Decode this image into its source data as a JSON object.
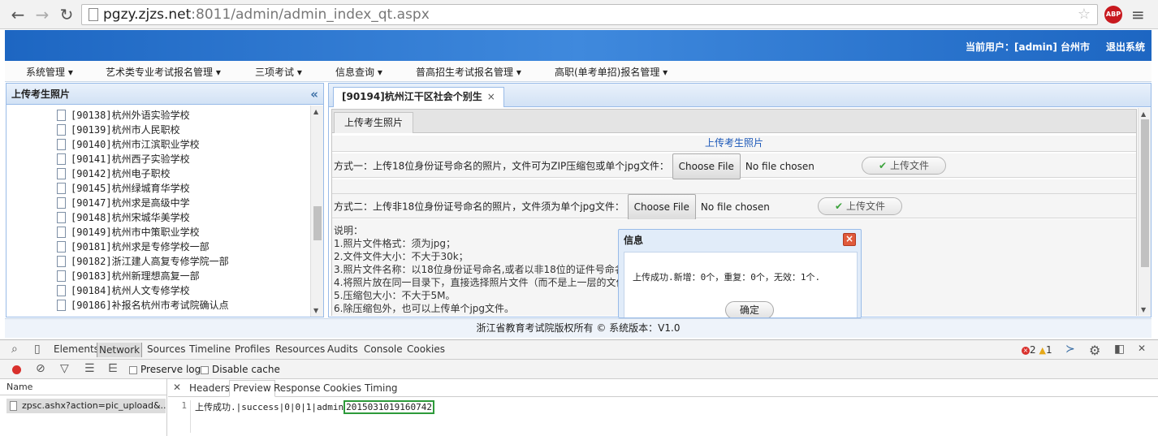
{
  "browser": {
    "url_host": "pgzy.zjzs.net",
    "url_path": ":8011/admin/admin_index_qt.aspx",
    "abp_label": "ABP"
  },
  "header": {
    "user_label": "当前用户：[admin] 台州市",
    "logout_label": "退出系统"
  },
  "menu": [
    "系统管理 ▾",
    "艺术类专业考试报名管理 ▾",
    "三项考试 ▾",
    "信息查询 ▾",
    "普高招生考试报名管理 ▾",
    "高职(单考单招)报名管理 ▾"
  ],
  "west": {
    "title": "上传考生照片",
    "collapse_icon": "«",
    "items": [
      "[90138]杭州外语实验学校",
      "[90139]杭州市人民职校",
      "[90140]杭州市江滨职业学校",
      "[90141]杭州西子实验学校",
      "[90142]杭州电子职校",
      "[90145]杭州绿城育华学校",
      "[90147]杭州求是高级中学",
      "[90148]杭州宋城华美学校",
      "[90149]杭州市中策职业学校",
      "[90181]杭州求是专修学校一部",
      "[90182]浙江建人高复专修学院一部",
      "[90183]杭州新理想高复一部",
      "[90184]杭州人文专修学校",
      "[90186]补报名杭州市考试院确认点"
    ]
  },
  "center": {
    "tab_label": "[90194]杭州江干区社会个别生",
    "tab_close": "×",
    "subtab_label": "上传考生照片",
    "section_title": "上传考生照片",
    "method1_label": "方式一：上传18位身份证号命名的照片，文件可为ZIP压缩包或单个jpg文件：",
    "method2_label": "方式二：上传非18位身份证号命名的照片，文件须为单个jpg文件：",
    "choose_file": "Choose File",
    "no_file": "No file chosen",
    "upload_label": "上传文件",
    "notes": [
      "说明：",
      "1.照片文件格式：须为jpg；",
      "2.文件文件大小：不大于30k；",
      "3.照片文件名称：以18位身份证号命名,或者以非18位的证件号命名",
      "4.将照片放在同一目录下，直接选择照片文件（而不是上一层的文件",
      "5.压缩包大小：不大于5M。",
      "6.除压缩包外，也可以上传单个jpg文件。"
    ]
  },
  "dialog": {
    "title": "信息",
    "message": "上传成功.新增：0个，重复：0个，无效：1个.",
    "ok_label": "确定"
  },
  "footer": {
    "text": "浙江省教育考试院版权所有 ©   系统版本：V1.0"
  },
  "devtools": {
    "tabs": [
      "Elements",
      "Network",
      "Sources",
      "Timeline",
      "Profiles",
      "Resources",
      "Audits",
      "Console",
      "Cookies"
    ],
    "error_count": "2",
    "warning_count": "1",
    "preserve_log": "Preserve log",
    "disable_cache": "Disable cache",
    "name_header": "Name",
    "request_name": "zpsc.ashx?action=pic_upload&...",
    "sub_tabs": [
      "Headers",
      "Preview",
      "Response",
      "Cookies",
      "Timing"
    ],
    "line_number": "1",
    "response_prefix": "上传成功.|success|0|0|1|admin",
    "response_highlight": "2015031019160742"
  }
}
